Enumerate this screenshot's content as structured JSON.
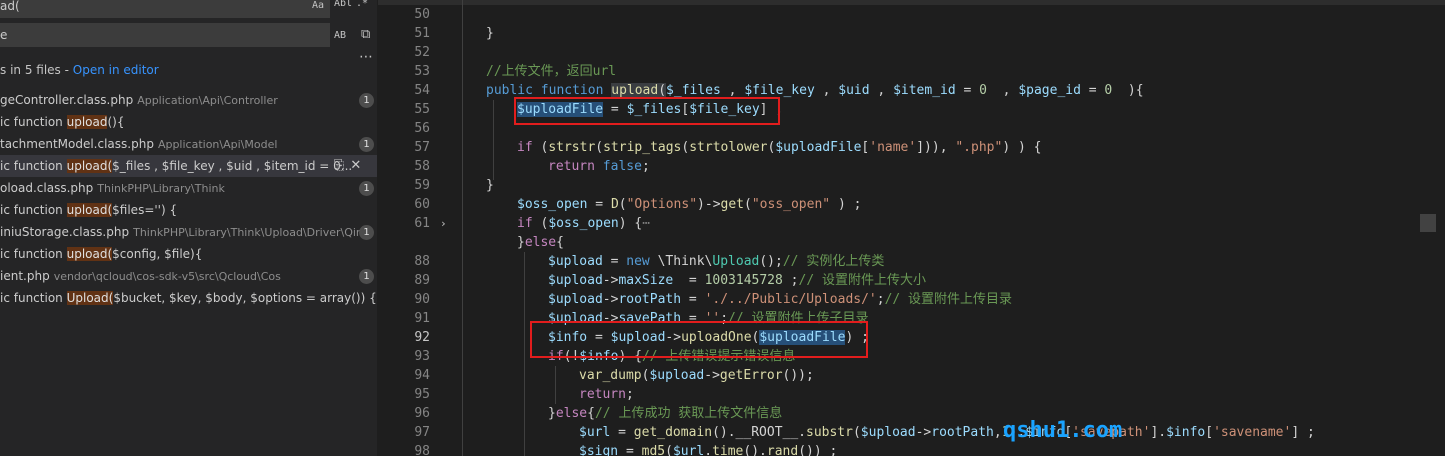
{
  "search": {
    "query": "ad(",
    "replace": "e",
    "opt_case": "Aa",
    "opt_word": "Abl",
    "opt_regex": ".*",
    "opt_preserve_case": "AB",
    "summary_prefix": "s in 5 files - ",
    "open_in_editor": "Open in editor"
  },
  "results": [
    {
      "kind": "file",
      "name": "geController.class.php",
      "path": "Application\\Api\\Controller",
      "count": "1"
    },
    {
      "kind": "match",
      "pre": "ic function ",
      "hit": "upload",
      "post": "(){"
    },
    {
      "kind": "file",
      "name": "tachmentModel.class.php",
      "path": "Application\\Api\\Model",
      "count": "1"
    },
    {
      "kind": "match",
      "pre": "ic function ",
      "hit": "upload(",
      "post": "$_files , $file_key , $uid , $item_id = 0...",
      "selected": true
    },
    {
      "kind": "file",
      "name": "oload.class.php",
      "path": "ThinkPHP\\Library\\Think",
      "count": "1"
    },
    {
      "kind": "match",
      "pre": "ic function ",
      "hit": "upload(",
      "post": "$files='') {"
    },
    {
      "kind": "file",
      "name": "iniuStorage.class.php",
      "path": "ThinkPHP\\Library\\Think\\Upload\\Driver\\Qiniu",
      "count": "1"
    },
    {
      "kind": "match",
      "pre": "ic function ",
      "hit": "upload(",
      "post": "$config, $file){"
    },
    {
      "kind": "file",
      "name": "ient.php",
      "path": "vendor\\qcloud\\cos-sdk-v5\\src\\Qcloud\\Cos",
      "count": "1"
    },
    {
      "kind": "match",
      "pre": "ic function ",
      "hit": "Upload(",
      "post": "$bucket, $key, $body, $options = array()) {"
    }
  ],
  "editor": {
    "line_numbers": [
      "50",
      "51",
      "52",
      "53",
      "54",
      "55",
      "56",
      "57",
      "58",
      "59",
      "60",
      "61",
      "88",
      "89",
      "90",
      "91",
      "92",
      "93",
      "94",
      "95",
      "96",
      "97",
      "98"
    ],
    "active_line": "92",
    "folded_line": "61",
    "icons": {
      "fold": "chevron-right-icon",
      "replace_all": "replace-all-icon",
      "collapse": "collapse-icon",
      "more": "more-icon",
      "preserve_case": "preserve-case-icon"
    }
  },
  "watermark": "qshu1.com"
}
